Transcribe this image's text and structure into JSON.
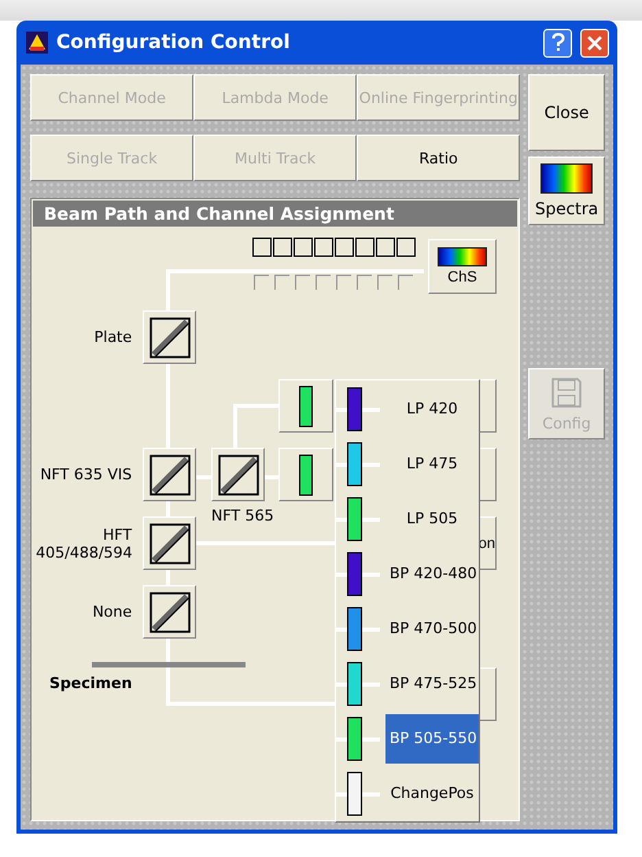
{
  "window": {
    "title": "Configuration Control"
  },
  "mode_buttons": [
    {
      "label": "Channel Mode",
      "disabled": true
    },
    {
      "label": "Lambda Mode",
      "disabled": true
    },
    {
      "label": "Online Fingerprinting",
      "disabled": true
    }
  ],
  "track_buttons": [
    {
      "label": "Single Track",
      "selected": false
    },
    {
      "label": "Multi Track",
      "selected": false
    },
    {
      "label": "Ratio",
      "selected": true
    }
  ],
  "side_buttons": {
    "close": "Close",
    "spectra": "Spectra",
    "config": {
      "label": "Config",
      "disabled": true
    }
  },
  "beam_path": {
    "title": "Beam Path and Channel Assignment",
    "chs_button": "ChS",
    "mirrors": [
      {
        "label": "Plate"
      },
      {
        "label": "NFT 635 VIS"
      },
      {
        "label": "NFT 565"
      },
      {
        "label": "HFT 405/488/594"
      },
      {
        "label": "None"
      }
    ],
    "specimen": "Specimen",
    "filter_buttons": [
      {
        "color": "#20e060"
      },
      {
        "color": "#20e060"
      }
    ],
    "hidden_button_text": "on",
    "filter_list": [
      {
        "label": "LP 420",
        "color": "#4010c8",
        "selected": false
      },
      {
        "label": "LP 475",
        "color": "#20c8e8",
        "selected": false
      },
      {
        "label": "LP 505",
        "color": "#20e060",
        "selected": false
      },
      {
        "label": "BP 420-480",
        "color": "#4010c8",
        "selected": false
      },
      {
        "label": "BP 470-500",
        "color": "#2090e8",
        "selected": false
      },
      {
        "label": "BP 475-525",
        "color": "#20d8d0",
        "selected": false
      },
      {
        "label": "BP 505-550",
        "color": "#20e060",
        "selected": true
      },
      {
        "label": "ChangePos",
        "color": "#f4f4f4",
        "selected": false
      }
    ]
  }
}
